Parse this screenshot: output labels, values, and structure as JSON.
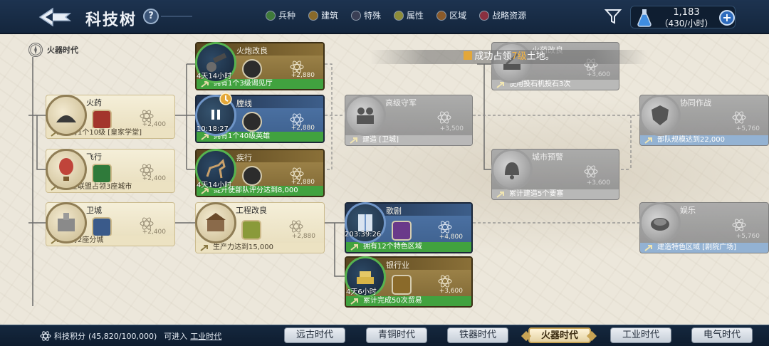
{
  "header": {
    "title": "科技树",
    "help_label": "?"
  },
  "legend": [
    {
      "label": "兵种",
      "color": "#3f7a3a"
    },
    {
      "label": "建筑",
      "color": "#8a6a2a"
    },
    {
      "label": "特殊",
      "color": "#3a3f55"
    },
    {
      "label": "属性",
      "color": "#8c8c3a"
    },
    {
      "label": "区域",
      "color": "#8a5a2a"
    },
    {
      "label": "战略资源",
      "color": "#8a3040"
    }
  ],
  "resource": {
    "amount": "1,183",
    "rate": "（430/小时）",
    "plus_label": "+"
  },
  "era_label": "火器时代",
  "toast": {
    "prefix": "成功占领",
    "level": "7级",
    "suffix": "土地。"
  },
  "techs": [
    {
      "id": "gunpowder",
      "name": "火药",
      "points": "+2,400",
      "req": "拥有1个10级 [皇家学堂]",
      "style": "parch"
    },
    {
      "id": "flight",
      "name": "飞行",
      "points": "+2,400",
      "req": "所在联盟占领3座城市",
      "style": "parch"
    },
    {
      "id": "guard_city",
      "name": "卫城",
      "points": "+2,400",
      "req": "拥有2座分城",
      "style": "parch"
    },
    {
      "id": "cannon_improve",
      "name": "火炮改良",
      "points": "+2,880",
      "req": "拥有1个3级谒见厅",
      "timer": "4天14小时",
      "style": "gold"
    },
    {
      "id": "chamber_line",
      "name": "膛线",
      "points": "+2,880",
      "req": "拥有1个40级英雄",
      "timer": "10:18:27",
      "style": "navy"
    },
    {
      "id": "rush",
      "name": "疾行",
      "points": "+2,880",
      "req": "提升使部队评分达到8,000",
      "timer": "4天14小时",
      "style": "gold"
    },
    {
      "id": "engineering",
      "name": "工程改良",
      "points": "+2,880",
      "req": "生产力达到15,000",
      "style": "parch"
    },
    {
      "id": "senior_guard",
      "name": "高级守军",
      "points": "+3,500",
      "req": "建造 [卫城]",
      "style": "grey"
    },
    {
      "id": "opera",
      "name": "歌剧",
      "points": "+4,800",
      "req": "拥有12个特色区域",
      "timer": "203:39:26",
      "style": "navy"
    },
    {
      "id": "banking",
      "name": "银行业",
      "points": "+3,600",
      "req": "累计完成50次贸易",
      "timer": "4天6小时",
      "style": "gold"
    },
    {
      "id": "gunpowder_improve",
      "name": "火药改良",
      "points": "+3,600",
      "req": "使用投石机投石3次",
      "style": "grey"
    },
    {
      "id": "city_warning",
      "name": "城市预警",
      "points": "+3,600",
      "req": "累计建造5个要塞",
      "style": "grey"
    },
    {
      "id": "coop_battle",
      "name": "协同作战",
      "points": "+5,760",
      "req": "部队规模达到22,000",
      "style": "grey"
    },
    {
      "id": "entertainment",
      "name": "娱乐",
      "points": "+5,760",
      "req": "建造特色区域 [剧院广场]",
      "style": "grey"
    }
  ],
  "footer": {
    "score_label": "科技积分",
    "score_value": "(45,820/100,000)",
    "enter_text": "可进入",
    "enter_link": "工业时代"
  },
  "era_tabs": [
    {
      "label": "远古时代",
      "active": false
    },
    {
      "label": "青铜时代",
      "active": false
    },
    {
      "label": "铁器时代",
      "active": false
    },
    {
      "label": "火器时代",
      "active": true
    },
    {
      "label": "工业时代",
      "active": false
    },
    {
      "label": "电气时代",
      "active": false
    }
  ]
}
